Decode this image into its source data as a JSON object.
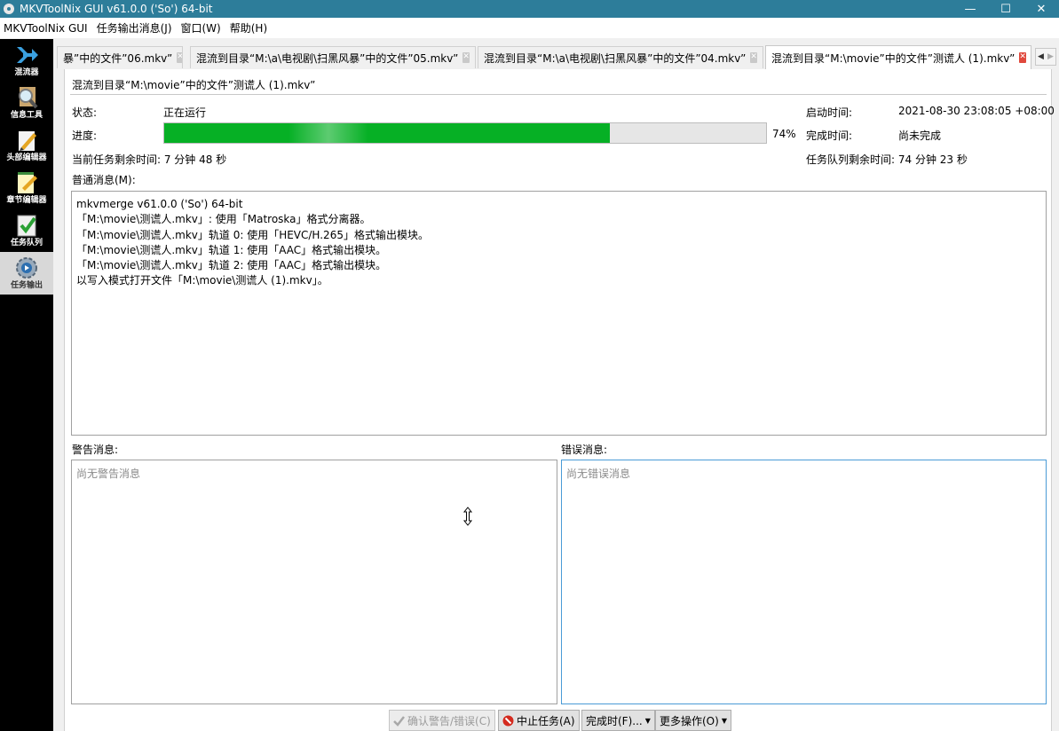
{
  "window": {
    "title": "MKVToolNix GUI v61.0.0 ('So') 64-bit",
    "controls": {
      "minimize": "—",
      "maximize": "☐",
      "close": "✕"
    }
  },
  "menu": [
    "MKVToolNix GUI",
    "任务输出消息(J)",
    "窗口(W)",
    "帮助(H)"
  ],
  "sidebar": [
    {
      "label": "混流器",
      "icon": "arrow-right-icon"
    },
    {
      "label": "信息工具",
      "icon": "magnifier-icon"
    },
    {
      "label": "头部编辑器",
      "icon": "pencil-icon"
    },
    {
      "label": "章节编辑器",
      "icon": "notepad-pencil-icon"
    },
    {
      "label": "任务队列",
      "icon": "checklist-icon"
    },
    {
      "label": "任务输出",
      "icon": "gear-output-icon"
    }
  ],
  "tabs": [
    {
      "label": "暴”中的文件”06.mkv”",
      "active": false
    },
    {
      "label": "混流到目录“M:\\a\\电视剧\\扫黑风暴”中的文件”05.mkv”",
      "active": false
    },
    {
      "label": "混流到目录“M:\\a\\电视剧\\扫黑风暴”中的文件”04.mkv”",
      "active": false
    },
    {
      "label": "混流到目录“M:\\movie”中的文件”测谎人 (1).mkv”",
      "active": true
    }
  ],
  "job": {
    "title": "混流到目录“M:\\movie”中的文件”测谎人 (1).mkv”",
    "status_label": "状态:",
    "status_value": "正在运行",
    "progress_label": "进度:",
    "progress_percent": 74,
    "progress_text": "74%",
    "start_label": "启动时间:",
    "start_value": "2021-08-30 23:08:05 +08:00",
    "finish_label": "完成时间:",
    "finish_value": "尚未完成",
    "remaining_current": "当前任务剩余时间: 7 分钟 48 秒",
    "remaining_queue": "任务队列剩余时间: 74 分钟 23 秒"
  },
  "messages": {
    "label": "普通消息(M):",
    "lines": [
      "mkvmerge v61.0.0 ('So') 64-bit",
      "「M:\\movie\\测谎人.mkv」: 使用「Matroska」格式分离器。",
      "「M:\\movie\\测谎人.mkv」轨道 0: 使用「HEVC/H.265」格式输出模块。",
      "「M:\\movie\\测谎人.mkv」轨道 1: 使用「AAC」格式输出模块。",
      "「M:\\movie\\测谎人.mkv」轨道 2: 使用「AAC」格式输出模块。",
      "以写入模式打开文件「M:\\movie\\测谎人 (1).mkv」。"
    ]
  },
  "warnings": {
    "label": "警告消息:",
    "placeholder": "尚无警告消息"
  },
  "errors": {
    "label": "错误消息:",
    "placeholder": "尚无错误消息"
  },
  "buttons": {
    "ack": "确认警告/错误(C)",
    "abort": "中止任务(A)",
    "when_done": "完成时(F)...",
    "more": "更多操作(O)"
  },
  "colors": {
    "titlebar": "#2d7d9a",
    "progress": "#06b025",
    "sidebar": "#000000",
    "close_tab": "#e0483c"
  }
}
